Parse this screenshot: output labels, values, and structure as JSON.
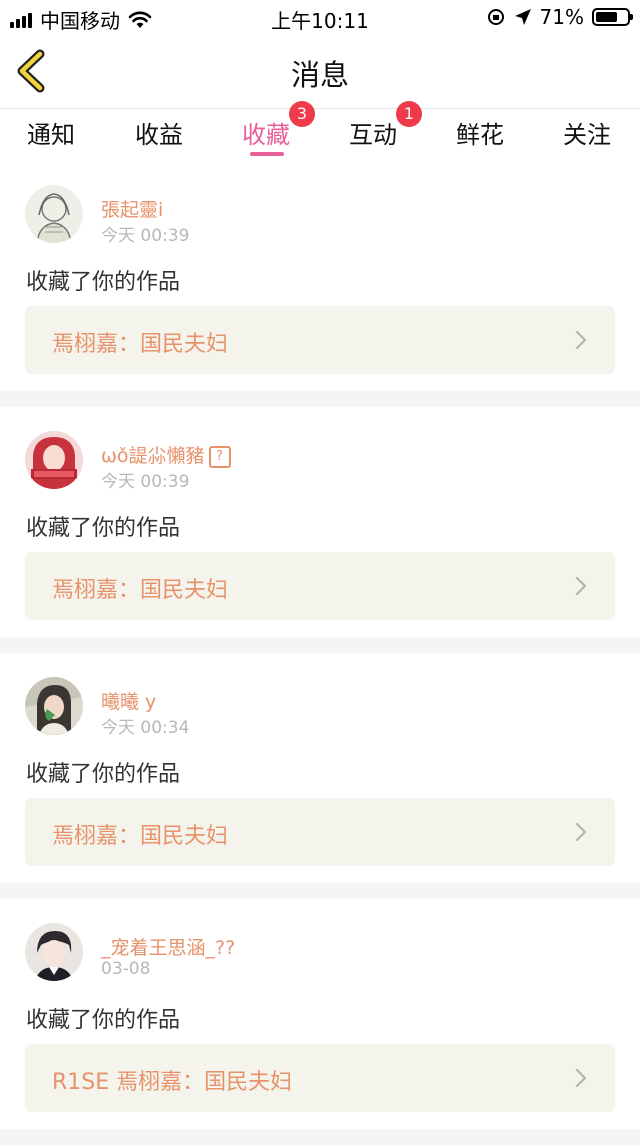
{
  "status_bar": {
    "carrier": "中国移动",
    "time": "上午10:11",
    "battery_text": "71%",
    "battery_level": 0.71
  },
  "nav": {
    "title": "消息",
    "back_icon": "chevron-left-icon"
  },
  "tabs": [
    {
      "label": "通知"
    },
    {
      "label": "收益"
    },
    {
      "label": "收藏",
      "badge": "3"
    },
    {
      "label": "互动",
      "badge": "1"
    },
    {
      "label": "鲜花"
    },
    {
      "label": "关注"
    }
  ],
  "active_tab": "收藏",
  "colors": {
    "accent": "#e8609a",
    "name": "#e7926a",
    "badge": "#ee3a4a"
  },
  "items": [
    {
      "user": "張起靈ⅰ",
      "time": "今天 00:39",
      "action": "收藏了你的作品",
      "work": "焉栩嘉：国民夫妇"
    },
    {
      "user": "ωǒ諟尛懶豬",
      "time": "今天 00:39",
      "action": "收藏了你的作品",
      "work": "焉栩嘉：国民夫妇"
    },
    {
      "user": "曦曦 y",
      "time": "今天 00:34",
      "action": "收藏了你的作品",
      "work": "焉栩嘉：国民夫妇"
    },
    {
      "user": "_宠着王思涵_??",
      "time": "03-08",
      "action": "收藏了你的作品",
      "work": "R1SE 焉栩嘉：国民夫妇"
    }
  ]
}
